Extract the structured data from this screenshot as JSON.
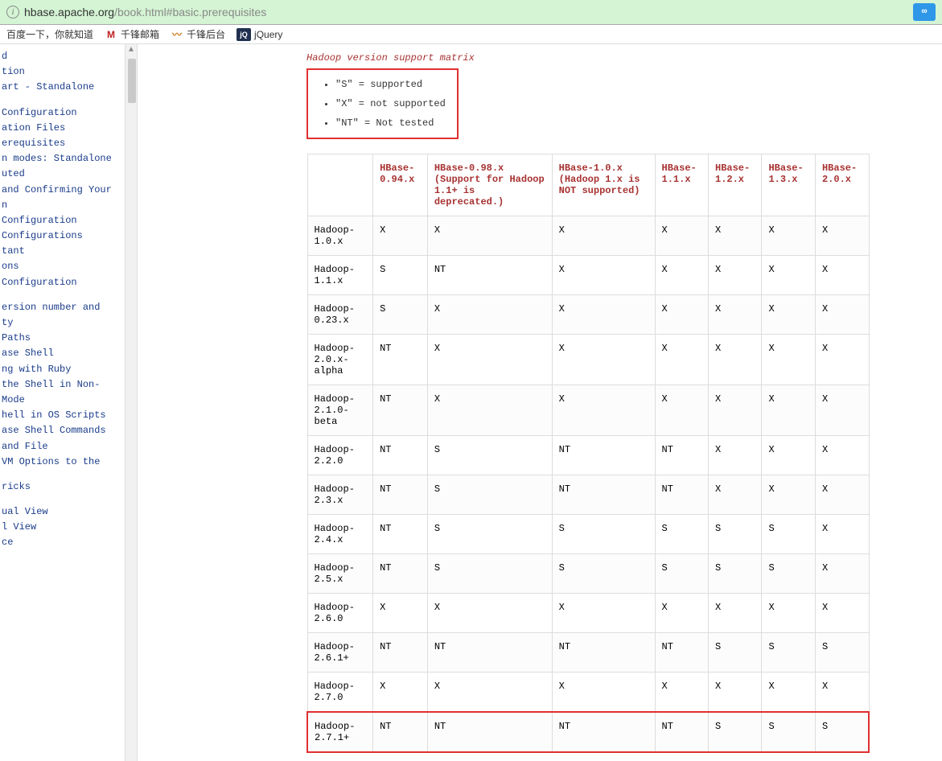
{
  "url": {
    "prefix": "",
    "host": "hbase.apache.org",
    "path": "/book.html#basic.prerequisites"
  },
  "bookmarks": [
    {
      "label": "百度一下，你就知道"
    },
    {
      "label": "千锋邮箱",
      "iconColor": "#c02020",
      "iconText": "M"
    },
    {
      "label": "千锋后台",
      "iconColor": "#d08020",
      "iconText": "〰"
    },
    {
      "label": "jQuery",
      "iconColor": "#203050",
      "iconText": "jQ"
    }
  ],
  "sidebar": [
    "d",
    "tion",
    "art - Standalone",
    "",
    "Configuration",
    "ation Files",
    "erequisites",
    "n modes: Standalone",
    "uted",
    "and Confirming Your",
    "n",
    "Configuration",
    "Configurations",
    "tant",
    "ons",
    " Configuration",
    "",
    "ersion number and",
    "ty",
    " Paths",
    "ase Shell",
    "ng with Ruby",
    " the Shell in Non-",
    " Mode",
    "hell in OS Scripts",
    "ase Shell Commands",
    "and File",
    " VM Options to the",
    "",
    "ricks",
    "",
    "ual View",
    "l View",
    "ce"
  ],
  "caption": "Hadoop version support matrix",
  "legend": [
    "\"S\" = supported",
    "\"X\" = not supported",
    "\"NT\" = Not tested"
  ],
  "headers": [
    "",
    "HBase-0.94.x",
    "HBase-0.98.x (Support for Hadoop 1.1+ is deprecated.)",
    "HBase-1.0.x (Hadoop 1.x is NOT supported)",
    "HBase-1.1.x",
    "HBase-1.2.x",
    "HBase-1.3.x",
    "HBase-2.0.x"
  ],
  "rows": [
    [
      "Hadoop-1.0.x",
      "X",
      "X",
      "X",
      "X",
      "X",
      "X",
      "X"
    ],
    [
      "Hadoop-1.1.x",
      "S",
      "NT",
      "X",
      "X",
      "X",
      "X",
      "X"
    ],
    [
      "Hadoop-0.23.x",
      "S",
      "X",
      "X",
      "X",
      "X",
      "X",
      "X"
    ],
    [
      "Hadoop-2.0.x-alpha",
      "NT",
      "X",
      "X",
      "X",
      "X",
      "X",
      "X"
    ],
    [
      "Hadoop-2.1.0-beta",
      "NT",
      "X",
      "X",
      "X",
      "X",
      "X",
      "X"
    ],
    [
      "Hadoop-2.2.0",
      "NT",
      "S",
      "NT",
      "NT",
      "X",
      "X",
      "X"
    ],
    [
      "Hadoop-2.3.x",
      "NT",
      "S",
      "NT",
      "NT",
      "X",
      "X",
      "X"
    ],
    [
      "Hadoop-2.4.x",
      "NT",
      "S",
      "S",
      "S",
      "S",
      "S",
      "X"
    ],
    [
      "Hadoop-2.5.x",
      "NT",
      "S",
      "S",
      "S",
      "S",
      "S",
      "X"
    ],
    [
      "Hadoop-2.6.0",
      "X",
      "X",
      "X",
      "X",
      "X",
      "X",
      "X"
    ],
    [
      "Hadoop-2.6.1+",
      "NT",
      "NT",
      "NT",
      "NT",
      "S",
      "S",
      "S"
    ],
    [
      "Hadoop-2.7.0",
      "X",
      "X",
      "X",
      "X",
      "X",
      "X",
      "X"
    ],
    [
      "Hadoop-2.7.1+",
      "NT",
      "NT",
      "NT",
      "NT",
      "S",
      "S",
      "S"
    ]
  ],
  "highlightRow": 12
}
